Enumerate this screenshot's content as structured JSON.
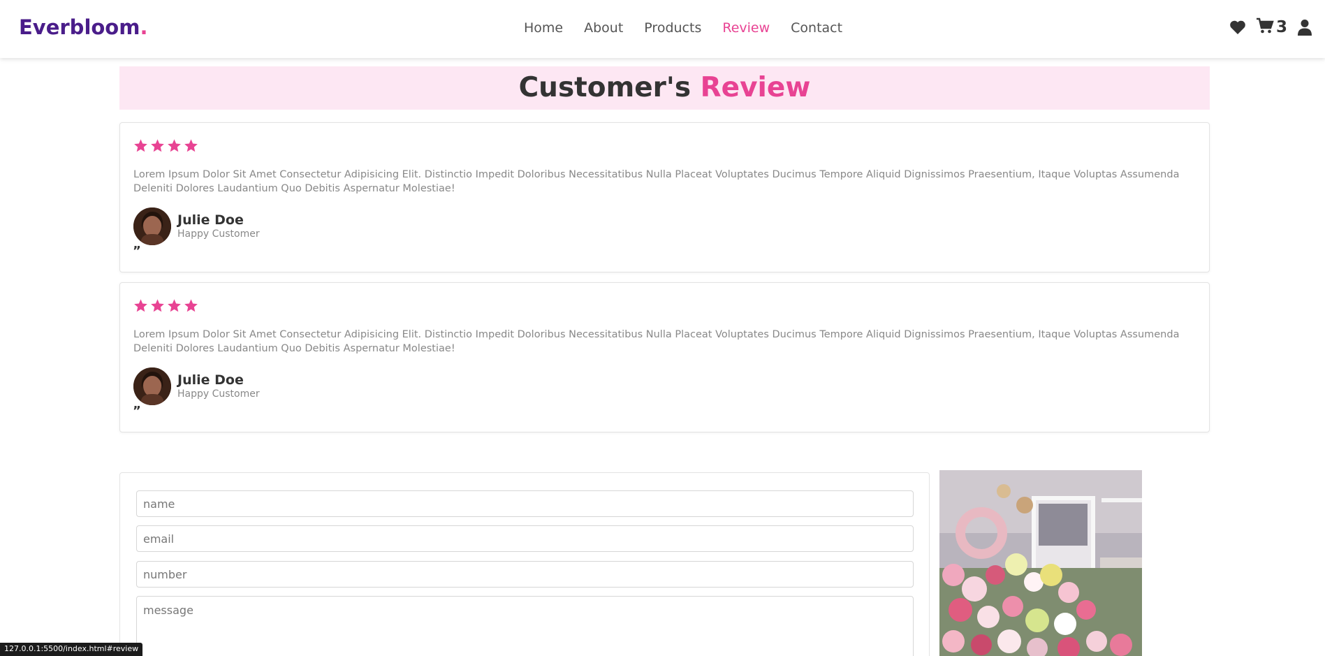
{
  "header": {
    "logo_text": "Everbloom",
    "logo_dot": ".",
    "nav": [
      {
        "label": "Home"
      },
      {
        "label": "About"
      },
      {
        "label": "Products"
      },
      {
        "label": "Review"
      },
      {
        "label": "Contact"
      }
    ],
    "active_nav": "Review",
    "cart_count": "3",
    "icons": [
      "heart-icon",
      "cart-icon",
      "user-icon"
    ]
  },
  "section": {
    "title_part1": "Customer's",
    "title_part2": "Review"
  },
  "reviews": [
    {
      "stars": 4,
      "text": "Lorem Ipsum Dolor Sit Amet Consectetur Adipisicing Elit. Distinctio Impedit Doloribus Necessitatibus Nulla Placeat Voluptates Ducimus Tempore Aliquid Dignissimos Praesentium, Itaque Voluptas Assumenda Deleniti Dolores Laudantium Quo Debitis Aspernatur Molestiae!",
      "name": "Julie Doe",
      "role": "Happy Customer",
      "quote": "”"
    },
    {
      "stars": 4,
      "text": "Lorem Ipsum Dolor Sit Amet Consectetur Adipisicing Elit. Distinctio Impedit Doloribus Necessitatibus Nulla Placeat Voluptates Ducimus Tempore Aliquid Dignissimos Praesentium, Itaque Voluptas Assumenda Deleniti Dolores Laudantium Quo Debitis Aspernatur Molestiae!",
      "name": "Julie Doe",
      "role": "Happy Customer",
      "quote": "”"
    }
  ],
  "contact_form": {
    "name_placeholder": "name",
    "email_placeholder": "email",
    "number_placeholder": "number",
    "message_placeholder": "message"
  },
  "status_bar": {
    "url": "127.0.0.1:5500/index.html#review"
  },
  "colors": {
    "brand": "#4a1d8a",
    "accent": "#e84393",
    "heading_bg": "#fde7f3"
  }
}
